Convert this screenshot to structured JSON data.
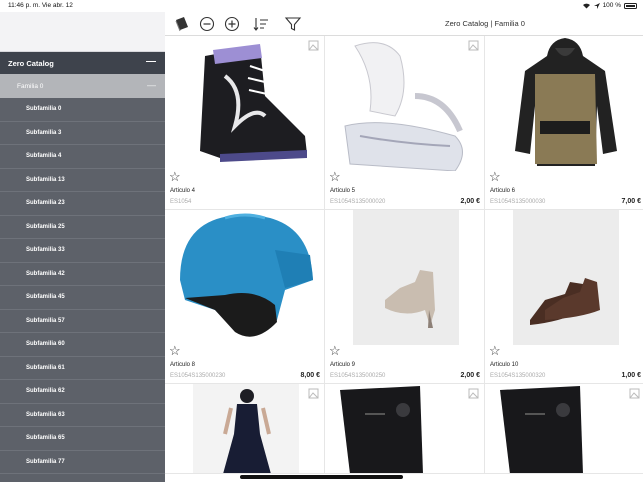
{
  "status_bar": {
    "time": "11:46 p. m.  Vie abr. 12",
    "battery": "100 %"
  },
  "sidebar": {
    "catalog": "Zero Catalog",
    "family": "Familia 0",
    "items": [
      "Subfamilia 0",
      "Subfamilia 3",
      "Subfamilia 4",
      "Subfamilia 13",
      "Subfamilia 23",
      "Subfamilia 25",
      "Subfamilia 33",
      "Subfamilia 42",
      "Subfamilia 45",
      "Subfamilia 57",
      "Subfamilia 60",
      "Subfamilia 61",
      "Subfamilia 62",
      "Subfamilia 63",
      "Subfamilia 65",
      "Subfamilia 77"
    ]
  },
  "header": {
    "title": "Zero Catalog | Familia 0"
  },
  "products": [
    {
      "name": "Articulo 4",
      "ref": "ES1054",
      "price": "",
      "image": "snowboard-boot"
    },
    {
      "name": "Articulo 5",
      "ref": "ES1054S135000020",
      "price": "2,00 €",
      "image": "snowboard-binding"
    },
    {
      "name": "Articulo 6",
      "ref": "ES1054S135000030",
      "price": "7,00 €",
      "image": "anorak-jacket"
    },
    {
      "name": "Articulo 8",
      "ref": "ES1054S135000230",
      "price": "8,00 €",
      "image": "ski-helmet"
    },
    {
      "name": "Articulo 9",
      "ref": "ES1054S135000250",
      "price": "2,00 €",
      "image": "heel-bootie"
    },
    {
      "name": "Articulo 10",
      "ref": "ES1054S135000320",
      "price": "1,00 €",
      "image": "desert-boots"
    },
    {
      "name": "",
      "ref": "",
      "price": "",
      "image": "black-dress"
    },
    {
      "name": "",
      "ref": "",
      "price": "",
      "image": "black-boot"
    },
    {
      "name": "",
      "ref": "",
      "price": "",
      "image": "black-boot"
    }
  ]
}
